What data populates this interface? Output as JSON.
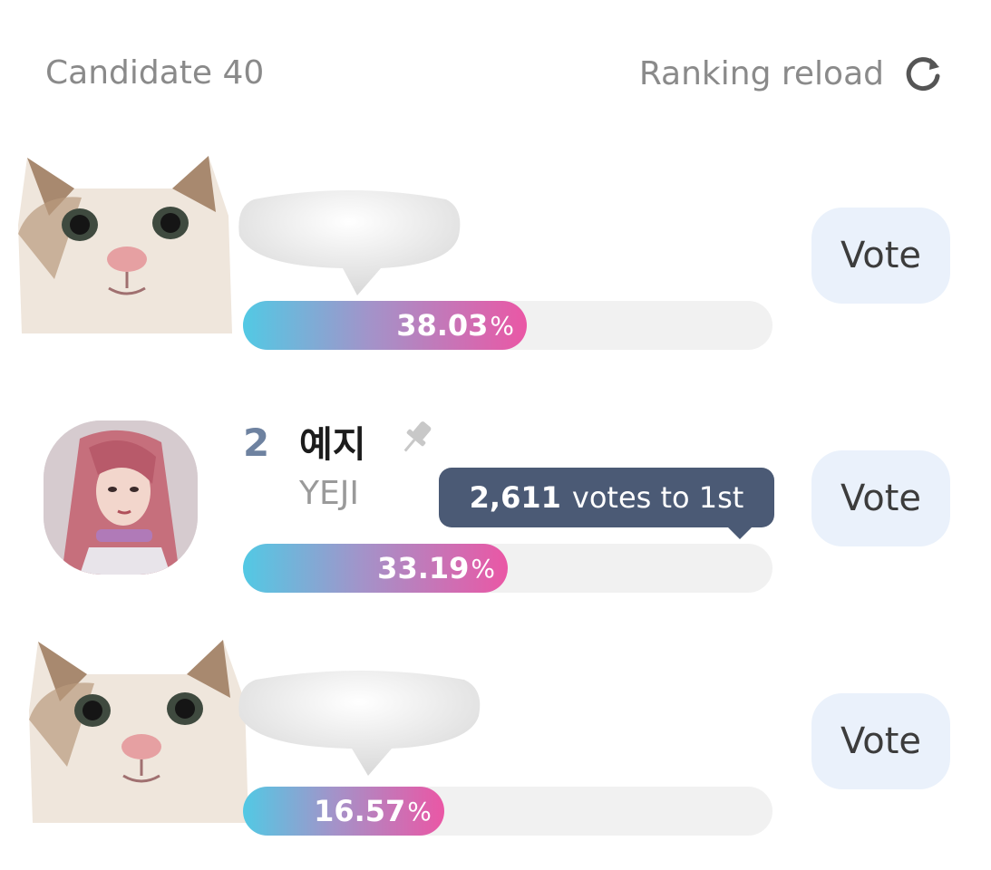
{
  "header": {
    "candidate_label": "Candidate 40",
    "reload_label": "Ranking reload",
    "reload_icon": "refresh-icon"
  },
  "rows": [
    {
      "percent": "38.03",
      "percent_sign": "%",
      "fill_fraction": 0.536,
      "vote_label": "Vote",
      "image": "cat-photo-sticker"
    },
    {
      "rank": "2",
      "name_ko": "예지",
      "name_en": "YEJI",
      "tooltip_votes": "2,611",
      "tooltip_text": "votes to 1st",
      "percent": "33.19",
      "percent_sign": "%",
      "fill_fraction": 0.5,
      "vote_label": "Vote",
      "image": "yeji-avatar",
      "pin_icon": "pin-icon"
    },
    {
      "percent": "16.57",
      "percent_sign": "%",
      "fill_fraction": 0.38,
      "vote_label": "Vote",
      "image": "cat-photo-sticker"
    }
  ],
  "colors": {
    "gradient_start": "#52c9e4",
    "gradient_mid": "#a393c9",
    "gradient_end": "#ea57a5",
    "vote_button_bg": "#eaf1fb",
    "tooltip_bg": "#4b5a75",
    "rank_color": "#6e82a0"
  }
}
